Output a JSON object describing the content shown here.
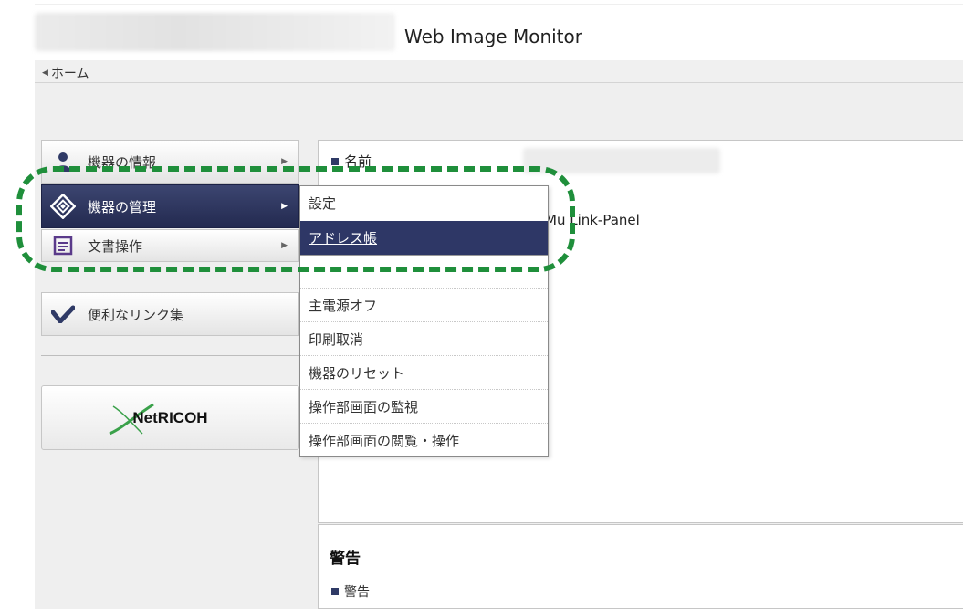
{
  "header": {
    "title": "Web Image Monitor"
  },
  "breadcrumb": {
    "home": "ホーム"
  },
  "side_menu": {
    "items": [
      {
        "label": "機器の情報",
        "icon": "device-info-icon"
      },
      {
        "label": "機器の管理",
        "icon": "device-management-icon",
        "active": true
      },
      {
        "label": "文書操作",
        "icon": "document-icon"
      },
      {
        "label": "便利なリンク集",
        "icon": "link-check-icon"
      }
    ],
    "netricoh": "NetRICOH"
  },
  "dropdown": {
    "items": [
      "設定",
      "アドレス帳",
      "主電源オフ",
      "印刷取消",
      "機器のリセット",
      "操作部画面の監視",
      "操作部画面の閲覧・操作"
    ],
    "highlighted_index": 1
  },
  "info": {
    "name_label": "名前",
    "model_text": "Mu   Link-Panel"
  },
  "warnings": {
    "title": "警告",
    "item": "警告"
  },
  "colors": {
    "active_menu": "#2e3766",
    "highlight_outline": "#1f8f3b",
    "panel_bg": "#efefef"
  }
}
